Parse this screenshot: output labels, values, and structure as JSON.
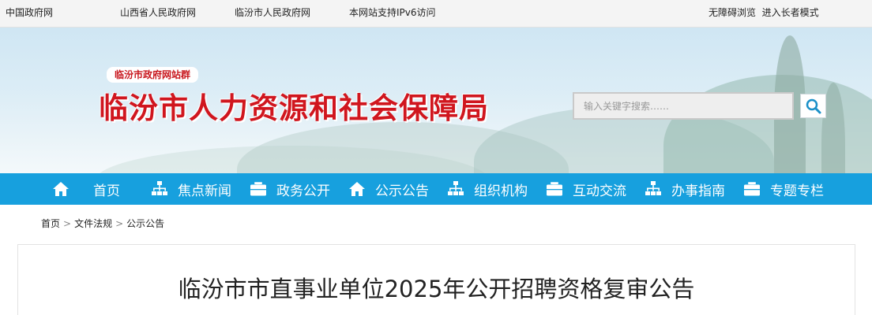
{
  "topbar": {
    "links": [
      "中国政府网",
      "山西省人民政府网",
      "临汾市人民政府网",
      "本网站支持IPv6访问"
    ],
    "accessibility": "无障碍浏览  进入长者模式"
  },
  "header": {
    "site_group": "临汾市政府网站群",
    "title": "临汾市人力资源和社会保障局",
    "search": {
      "placeholder": "输入关键字搜索……"
    }
  },
  "nav": {
    "items": [
      {
        "label": "首页",
        "icon": "home-icon"
      },
      {
        "label": "焦点新闻",
        "icon": "sitemap-icon"
      },
      {
        "label": "政务公开",
        "icon": "briefcase-icon"
      },
      {
        "label": "公示公告",
        "icon": "home-icon"
      },
      {
        "label": "组织机构",
        "icon": "sitemap-icon"
      },
      {
        "label": "互动交流",
        "icon": "briefcase-icon"
      },
      {
        "label": "办事指南",
        "icon": "sitemap-icon"
      },
      {
        "label": "专题专栏",
        "icon": "briefcase-icon"
      }
    ]
  },
  "breadcrumb": {
    "items": [
      "首页",
      "文件法规",
      "公示公告"
    ],
    "separator": ">"
  },
  "article": {
    "title": "临汾市市直事业单位2025年公开招聘资格复审公告"
  },
  "colors": {
    "nav_bg": "#17a0de",
    "title_red": "#d0161e"
  }
}
